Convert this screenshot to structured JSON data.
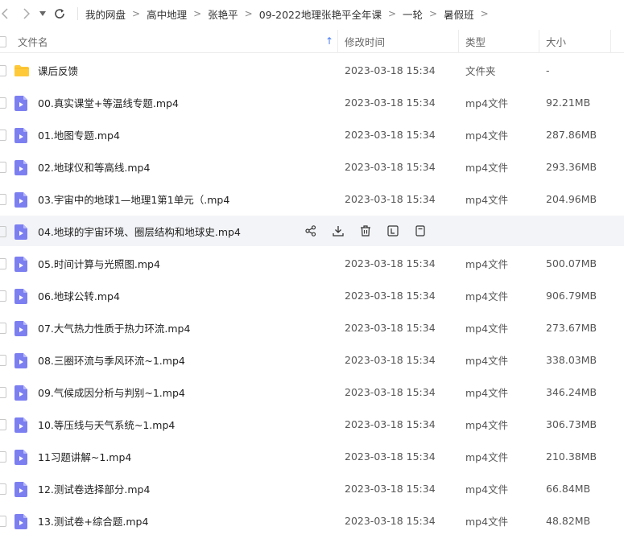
{
  "toolbar": {
    "back_icon": "chevron-left-icon",
    "forward_icon": "chevron-right-icon",
    "dropdown_icon": "caret-down-icon",
    "refresh_icon": "refresh-icon"
  },
  "breadcrumb": [
    "我的网盘",
    "高中地理",
    "张艳平",
    "09-2022地理张艳平全年课",
    "一轮",
    "暑假班"
  ],
  "breadcrumb_separator": ">",
  "columns": {
    "name": "文件名",
    "sort_arrow": "↑",
    "modified": "修改时间",
    "type": "类型",
    "size": "大小"
  },
  "colors": {
    "accent": "#4a7cf6",
    "folder": "#ffca3a",
    "video": "#7c7ff0",
    "row_hover": "#f3f4f7"
  },
  "row_actions": [
    "share-icon",
    "download-icon",
    "delete-icon",
    "rename-icon",
    "more-icon"
  ],
  "files": [
    {
      "name": "课后反馈",
      "date": "2023-03-18 15:34",
      "type": "文件夹",
      "size": "-",
      "kind": "folder"
    },
    {
      "name": "00.真实课堂+等温线专题.mp4",
      "date": "2023-03-18 15:34",
      "type": "mp4文件",
      "size": "92.21MB",
      "kind": "video"
    },
    {
      "name": "01.地图专题.mp4",
      "date": "2023-03-18 15:34",
      "type": "mp4文件",
      "size": "287.86MB",
      "kind": "video"
    },
    {
      "name": "02.地球仪和等高线.mp4",
      "date": "2023-03-18 15:34",
      "type": "mp4文件",
      "size": "293.36MB",
      "kind": "video"
    },
    {
      "name": "03.宇宙中的地球1—地理1第1单元（.mp4",
      "date": "2023-03-18 15:34",
      "type": "mp4文件",
      "size": "204.96MB",
      "kind": "video"
    },
    {
      "name": "04.地球的宇宙环境、圈层结构和地球史.mp4",
      "date": "",
      "type": "",
      "size": "",
      "kind": "video",
      "hovered": true
    },
    {
      "name": "05.时间计算与光照图.mp4",
      "date": "2023-03-18 15:34",
      "type": "mp4文件",
      "size": "500.07MB",
      "kind": "video"
    },
    {
      "name": "06.地球公转.mp4",
      "date": "2023-03-18 15:34",
      "type": "mp4文件",
      "size": "906.79MB",
      "kind": "video"
    },
    {
      "name": "07.大气热力性质于热力环流.mp4",
      "date": "2023-03-18 15:34",
      "type": "mp4文件",
      "size": "273.67MB",
      "kind": "video"
    },
    {
      "name": "08.三圈环流与季风环流~1.mp4",
      "date": "2023-03-18 15:34",
      "type": "mp4文件",
      "size": "338.03MB",
      "kind": "video"
    },
    {
      "name": "09.气候成因分析与判别~1.mp4",
      "date": "2023-03-18 15:34",
      "type": "mp4文件",
      "size": "346.24MB",
      "kind": "video"
    },
    {
      "name": "10.等压线与天气系统~1.mp4",
      "date": "2023-03-18 15:34",
      "type": "mp4文件",
      "size": "306.73MB",
      "kind": "video"
    },
    {
      "name": "11习题讲解~1.mp4",
      "date": "2023-03-18 15:34",
      "type": "mp4文件",
      "size": "210.38MB",
      "kind": "video"
    },
    {
      "name": "12.测试卷选择部分.mp4",
      "date": "2023-03-18 15:34",
      "type": "mp4文件",
      "size": "66.84MB",
      "kind": "video"
    },
    {
      "name": "13.测试卷+综合题.mp4",
      "date": "2023-03-18 15:34",
      "type": "mp4文件",
      "size": "48.82MB",
      "kind": "video"
    }
  ]
}
